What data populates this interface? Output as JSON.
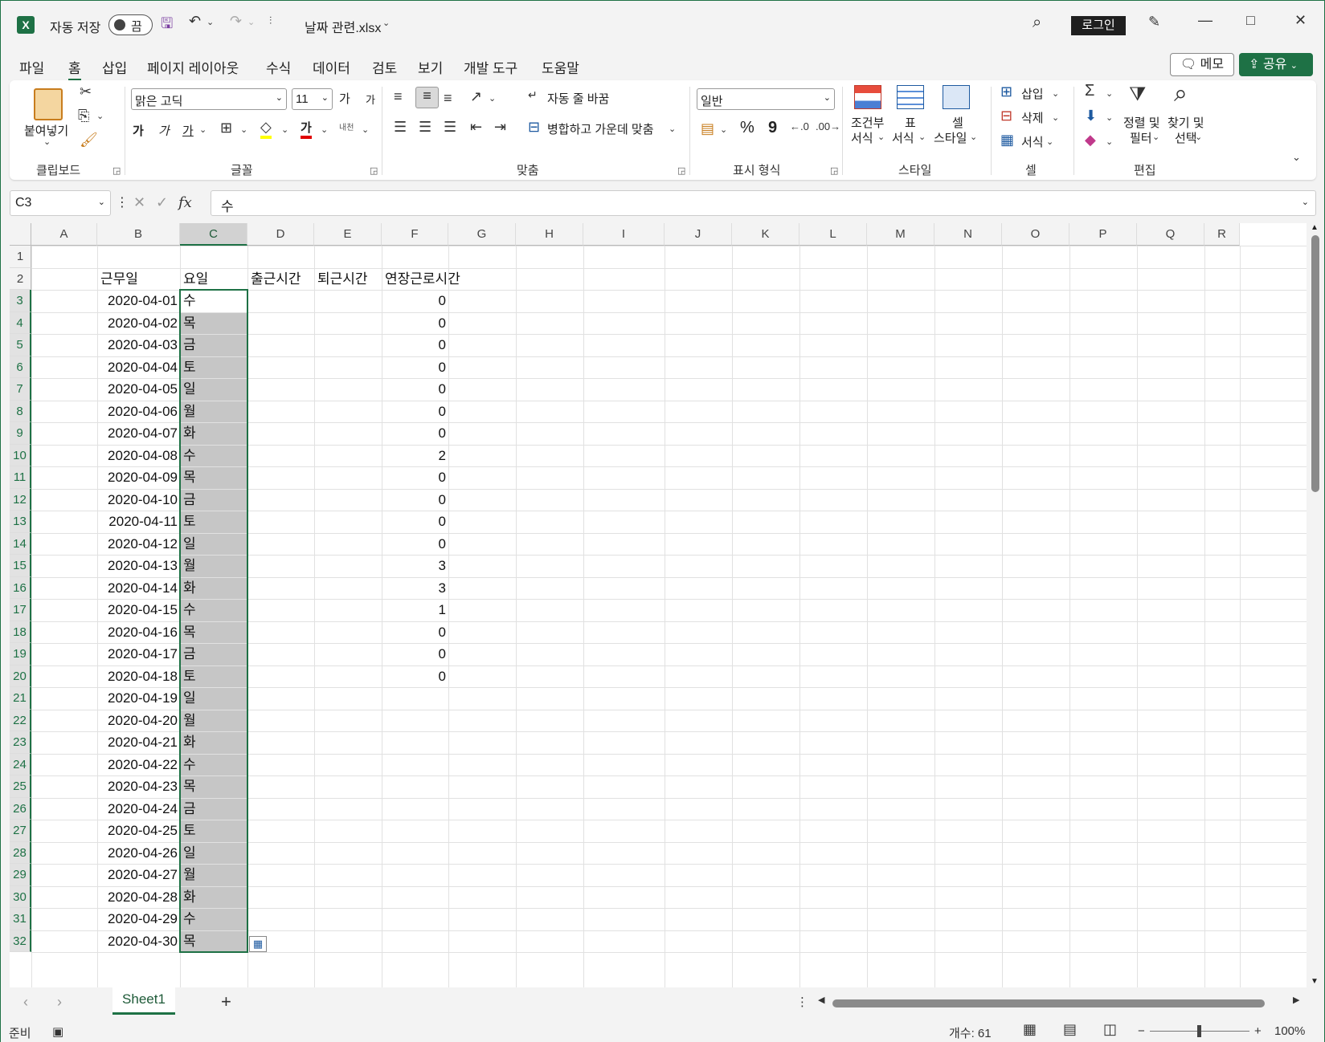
{
  "titlebar": {
    "autosave_label": "자동 저장",
    "autosave_state": "끔",
    "filename": "날짜 관련.xlsx",
    "login_label": "로그인"
  },
  "menu": {
    "items": [
      "파일",
      "홈",
      "삽입",
      "페이지 레이아웃",
      "수식",
      "데이터",
      "검토",
      "보기",
      "개발 도구",
      "도움말"
    ],
    "active": "홈",
    "memo_label": "메모",
    "share_label": "공유"
  },
  "ribbon": {
    "clipboard": {
      "paste_label": "붙여넣기",
      "group": "클립보드"
    },
    "font": {
      "name": "맑은 고딕",
      "size": "11",
      "bold": "가",
      "italic": "가",
      "underline": "가",
      "grow": "가",
      "shrink": "가",
      "color_a": "가",
      "phonetic": "내천",
      "group": "글꼴"
    },
    "alignment": {
      "wrap_label": "자동 줄 바꿈",
      "merge_label": "병합하고 가운데 맞춤",
      "group": "맞춤"
    },
    "number": {
      "format": "일반",
      "percent": "%",
      "comma": "9",
      "group": "표시 형식"
    },
    "styles": {
      "conditional_l1": "조건부",
      "conditional_l2": "서식",
      "table_l1": "표",
      "table_l2": "서식",
      "cell_l1": "셀",
      "cell_l2": "스타일",
      "group": "스타일"
    },
    "cells": {
      "insert": "삽입",
      "delete": "삭제",
      "format": "서식",
      "group": "셀"
    },
    "editing": {
      "sort_l1": "정렬 및",
      "sort_l2": "필터",
      "find_l1": "찾기 및",
      "find_l2": "선택",
      "group": "편집"
    }
  },
  "formula_bar": {
    "name_box": "C3",
    "fx": "fx",
    "content": "수"
  },
  "sheet": {
    "columns": [
      "A",
      "B",
      "C",
      "D",
      "E",
      "F",
      "G",
      "H",
      "I",
      "J",
      "K",
      "L",
      "M",
      "N",
      "O",
      "P",
      "Q",
      "R"
    ],
    "selected_column": "C",
    "headers": {
      "B": "근무일",
      "C": "요일",
      "D": "출근시간",
      "E": "퇴근시간",
      "F": "연장근로시간"
    },
    "rows": [
      {
        "row": "1"
      },
      {
        "row": "2"
      },
      {
        "row": "3",
        "date": "2020-04-01",
        "day": "수",
        "ot": "0"
      },
      {
        "row": "4",
        "date": "2020-04-02",
        "day": "목",
        "ot": "0"
      },
      {
        "row": "5",
        "date": "2020-04-03",
        "day": "금",
        "ot": "0"
      },
      {
        "row": "6",
        "date": "2020-04-04",
        "day": "토",
        "ot": "0"
      },
      {
        "row": "7",
        "date": "2020-04-05",
        "day": "일",
        "ot": "0"
      },
      {
        "row": "8",
        "date": "2020-04-06",
        "day": "월",
        "ot": "0"
      },
      {
        "row": "9",
        "date": "2020-04-07",
        "day": "화",
        "ot": "0"
      },
      {
        "row": "10",
        "date": "2020-04-08",
        "day": "수",
        "ot": "2"
      },
      {
        "row": "11",
        "date": "2020-04-09",
        "day": "목",
        "ot": "0"
      },
      {
        "row": "12",
        "date": "2020-04-10",
        "day": "금",
        "ot": "0"
      },
      {
        "row": "13",
        "date": "2020-04-11",
        "day": "토",
        "ot": "0"
      },
      {
        "row": "14",
        "date": "2020-04-12",
        "day": "일",
        "ot": "0"
      },
      {
        "row": "15",
        "date": "2020-04-13",
        "day": "월",
        "ot": "3"
      },
      {
        "row": "16",
        "date": "2020-04-14",
        "day": "화",
        "ot": "3"
      },
      {
        "row": "17",
        "date": "2020-04-15",
        "day": "수",
        "ot": "1"
      },
      {
        "row": "18",
        "date": "2020-04-16",
        "day": "목",
        "ot": "0"
      },
      {
        "row": "19",
        "date": "2020-04-17",
        "day": "금",
        "ot": "0"
      },
      {
        "row": "20",
        "date": "2020-04-18",
        "day": "토",
        "ot": "0"
      },
      {
        "row": "21",
        "date": "2020-04-19",
        "day": "일"
      },
      {
        "row": "22",
        "date": "2020-04-20",
        "day": "월"
      },
      {
        "row": "23",
        "date": "2020-04-21",
        "day": "화"
      },
      {
        "row": "24",
        "date": "2020-04-22",
        "day": "수"
      },
      {
        "row": "25",
        "date": "2020-04-23",
        "day": "목"
      },
      {
        "row": "26",
        "date": "2020-04-24",
        "day": "금"
      },
      {
        "row": "27",
        "date": "2020-04-25",
        "day": "토"
      },
      {
        "row": "28",
        "date": "2020-04-26",
        "day": "일"
      },
      {
        "row": "29",
        "date": "2020-04-27",
        "day": "월"
      },
      {
        "row": "30",
        "date": "2020-04-28",
        "day": "화"
      },
      {
        "row": "31",
        "date": "2020-04-29",
        "day": "수"
      },
      {
        "row": "32",
        "date": "2020-04-30",
        "day": "목"
      }
    ]
  },
  "tabs": {
    "sheet_name": "Sheet1",
    "add": "+"
  },
  "status": {
    "ready": "준비",
    "count": "개수: 61",
    "zoom": "100%"
  },
  "colors": {
    "accent": "#1e7145",
    "selection": "#c6c6c6"
  }
}
